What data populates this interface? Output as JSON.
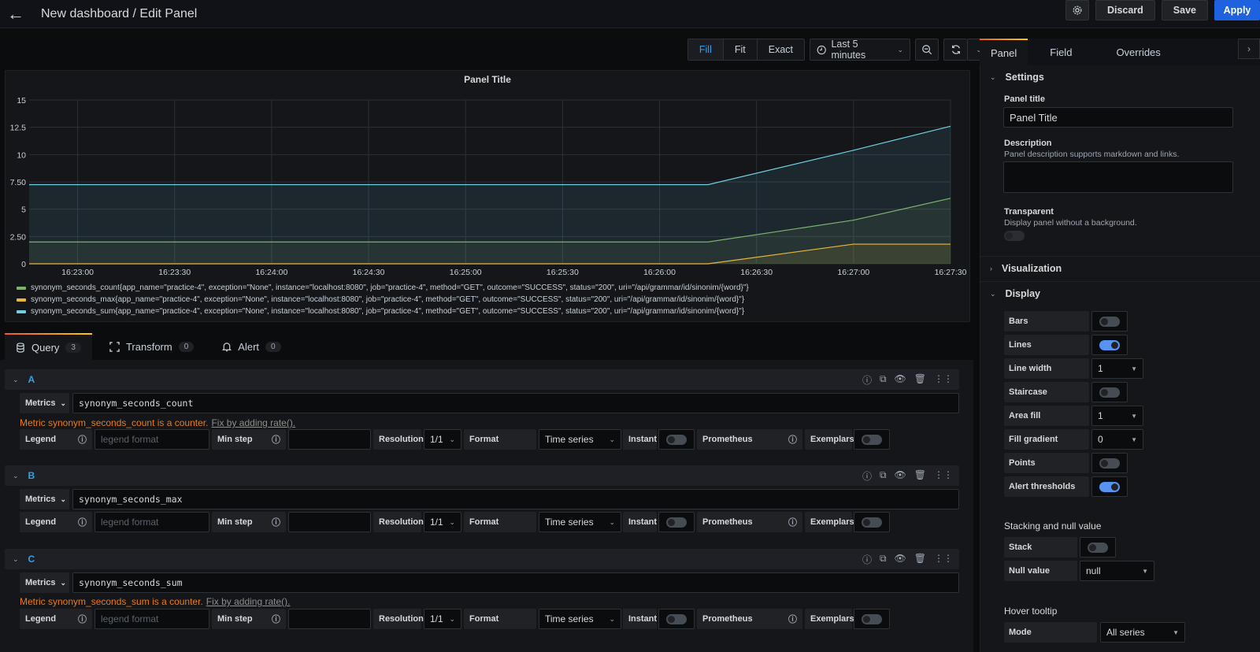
{
  "header": {
    "title": "New dashboard / Edit Panel",
    "buttons": {
      "settings_icon": "gear-icon",
      "discard": "Discard",
      "save": "Save",
      "apply": "Apply"
    }
  },
  "viewbar": {
    "modes": [
      "Fill",
      "Fit",
      "Exact"
    ],
    "active_mode": "Fill",
    "time_range": "Last 5 minutes"
  },
  "panel": {
    "title": "Panel Title"
  },
  "chart_data": {
    "type": "area",
    "title": "Panel Title",
    "xlabel": "",
    "ylabel": "",
    "x_ticks": [
      "16:23:00",
      "16:23:30",
      "16:24:00",
      "16:24:30",
      "16:25:00",
      "16:25:30",
      "16:26:00",
      "16:26:30",
      "16:27:00",
      "16:27:30"
    ],
    "y_ticks": [
      "0",
      "2.50",
      "5",
      "7.50",
      "10",
      "12.5",
      "15"
    ],
    "ylim": [
      0,
      15
    ],
    "x_range_seconds": [
      -15,
      270
    ],
    "grid": true,
    "legend_position": "bottom",
    "series": [
      {
        "name": "synonym_seconds_count{app_name=\"practice-4\", exception=\"None\", instance=\"localhost:8080\", job=\"practice-4\", method=\"GET\", outcome=\"SUCCESS\", status=\"200\", uri=\"/api/grammar/id/sinonim/{word}\"}",
        "color": "#7eb26d",
        "x": [
          -15,
          195,
          240,
          270
        ],
        "values": [
          2,
          2,
          4,
          6
        ]
      },
      {
        "name": "synonym_seconds_max{app_name=\"practice-4\", exception=\"None\", instance=\"localhost:8080\", job=\"practice-4\", method=\"GET\", outcome=\"SUCCESS\", status=\"200\", uri=\"/api/grammar/id/sinonim/{word}\"}",
        "color": "#eab839",
        "x": [
          -15,
          195,
          240,
          270
        ],
        "values": [
          0,
          0,
          1.8,
          1.8
        ]
      },
      {
        "name": "synonym_seconds_sum{app_name=\"practice-4\", exception=\"None\", instance=\"localhost:8080\", job=\"practice-4\", method=\"GET\", outcome=\"SUCCESS\", status=\"200\", uri=\"/api/grammar/id/sinonim/{word}\"}",
        "color": "#6ed0e0",
        "x": [
          -15,
          195,
          240,
          270
        ],
        "values": [
          7.25,
          7.25,
          10.4,
          12.6
        ]
      }
    ]
  },
  "query_tabs": [
    {
      "label": "Query",
      "count": "3",
      "icon": "database-icon"
    },
    {
      "label": "Transform",
      "count": "0",
      "icon": "transform-icon"
    },
    {
      "label": "Alert",
      "count": "0",
      "icon": "bell-icon"
    }
  ],
  "queries": [
    {
      "letter": "A",
      "metrics_label": "Metrics",
      "expr": "synonym_seconds_count",
      "warning": "Metric synonym_seconds_count is a counter.",
      "fix": "Fix by adding rate().",
      "legend_label": "Legend",
      "legend_placeholder": "legend format",
      "min_step_label": "Min step",
      "resolution_label": "Resolution",
      "resolution": "1/1",
      "format_label": "Format",
      "format": "Time series",
      "instant_label": "Instant",
      "prometheus_label": "Prometheus",
      "exemplars_label": "Exemplars"
    },
    {
      "letter": "B",
      "metrics_label": "Metrics",
      "expr": "synonym_seconds_max",
      "warning": "",
      "fix": "",
      "legend_label": "Legend",
      "legend_placeholder": "legend format",
      "min_step_label": "Min step",
      "resolution_label": "Resolution",
      "resolution": "1/1",
      "format_label": "Format",
      "format": "Time series",
      "instant_label": "Instant",
      "prometheus_label": "Prometheus",
      "exemplars_label": "Exemplars"
    },
    {
      "letter": "C",
      "metrics_label": "Metrics",
      "expr": "synonym_seconds_sum",
      "warning": "Metric synonym_seconds_sum is a counter.",
      "fix": "Fix by adding rate().",
      "legend_label": "Legend",
      "legend_placeholder": "legend format",
      "min_step_label": "Min step",
      "resolution_label": "Resolution",
      "resolution": "1/1",
      "format_label": "Format",
      "format": "Time series",
      "instant_label": "Instant",
      "prometheus_label": "Prometheus",
      "exemplars_label": "Exemplars"
    }
  ],
  "sidebar": {
    "tabs": [
      "Panel",
      "Field",
      "Overrides"
    ],
    "settings": {
      "heading": "Settings",
      "panel_title_label": "Panel title",
      "panel_title_value": "Panel Title",
      "description_label": "Description",
      "description_hint": "Panel description supports markdown and links.",
      "transparent_label": "Transparent",
      "transparent_hint": "Display panel without a background.",
      "transparent": false
    },
    "visualization_heading": "Visualization",
    "display": {
      "heading": "Display",
      "bars_label": "Bars",
      "bars": false,
      "lines_label": "Lines",
      "lines": true,
      "line_width_label": "Line width",
      "line_width": "1",
      "staircase_label": "Staircase",
      "staircase": false,
      "area_fill_label": "Area fill",
      "area_fill": "1",
      "fill_gradient_label": "Fill gradient",
      "fill_gradient": "0",
      "points_label": "Points",
      "points": false,
      "alert_thresholds_label": "Alert thresholds",
      "alert_thresholds": true
    },
    "stacking": {
      "heading": "Stacking and null value",
      "stack_label": "Stack",
      "stack": false,
      "null_value_label": "Null value",
      "null_value": "null"
    },
    "tooltip": {
      "heading": "Hover tooltip",
      "mode_label": "Mode",
      "mode": "All series"
    }
  }
}
